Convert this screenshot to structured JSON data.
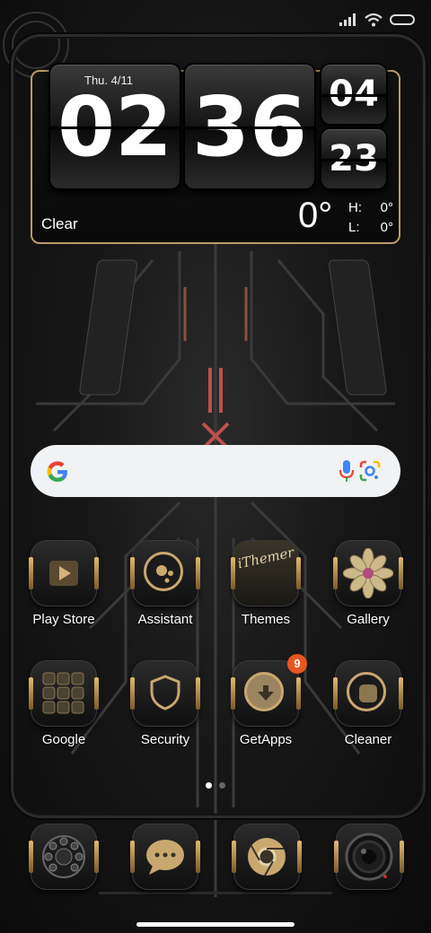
{
  "widget": {
    "date": "Thu. 4/11",
    "hour": "02",
    "minute": "36",
    "small_top": "04",
    "small_bottom": "23",
    "condition": "Clear",
    "temperature": "0°",
    "high_label": "H:",
    "high_value": "0°",
    "low_label": "L:",
    "low_value": "0°"
  },
  "apps": [
    {
      "label": "Play Store",
      "icon": "play-store-icon"
    },
    {
      "label": "Assistant",
      "icon": "assistant-icon"
    },
    {
      "label": "Themes",
      "icon": "themes-icon",
      "icon_text": "iThemer"
    },
    {
      "label": "Gallery",
      "icon": "gallery-flower-icon"
    },
    {
      "label": "Google",
      "icon": "google-folder-icon"
    },
    {
      "label": "Security",
      "icon": "shield-icon"
    },
    {
      "label": "GetApps",
      "icon": "getapps-icon",
      "badge": "9"
    },
    {
      "label": "Cleaner",
      "icon": "cleaner-icon"
    }
  ],
  "dock": [
    {
      "icon": "rotary-phone-icon"
    },
    {
      "icon": "messages-icon"
    },
    {
      "icon": "chrome-icon"
    },
    {
      "icon": "camera-icon"
    }
  ],
  "colors": {
    "accent_gold": "#c9a870",
    "badge": "#e8561f",
    "circuit_red": "#c0504a"
  }
}
